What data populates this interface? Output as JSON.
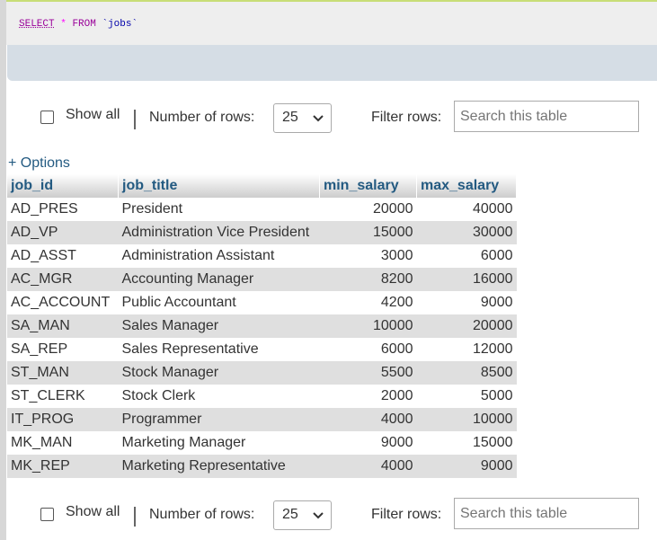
{
  "sql": {
    "keyword_select": "SELECT",
    "star": "*",
    "keyword_from": "FROM",
    "table_ident": "`jobs`"
  },
  "nav": {
    "show_all_label": "Show all",
    "rows_label": "Number of rows:",
    "rows_value": "25",
    "filter_label": "Filter rows:",
    "search_placeholder": "Search this table"
  },
  "options_label": "+ Options",
  "table": {
    "columns": [
      "job_id",
      "job_title",
      "min_salary",
      "max_salary"
    ],
    "rows": [
      [
        "AD_PRES",
        "President",
        "20000",
        "40000"
      ],
      [
        "AD_VP",
        "Administration Vice President",
        "15000",
        "30000"
      ],
      [
        "AD_ASST",
        "Administration Assistant",
        "3000",
        "6000"
      ],
      [
        "AC_MGR",
        "Accounting Manager",
        "8200",
        "16000"
      ],
      [
        "AC_ACCOUNT",
        "Public Accountant",
        "4200",
        "9000"
      ],
      [
        "SA_MAN",
        "Sales Manager",
        "10000",
        "20000"
      ],
      [
        "SA_REP",
        "Sales Representative",
        "6000",
        "12000"
      ],
      [
        "ST_MAN",
        "Stock Manager",
        "5500",
        "8500"
      ],
      [
        "ST_CLERK",
        "Stock Clerk",
        "2000",
        "5000"
      ],
      [
        "IT_PROG",
        "Programmer",
        "4000",
        "10000"
      ],
      [
        "MK_MAN",
        "Marketing Manager",
        "9000",
        "15000"
      ],
      [
        "MK_REP",
        "Marketing Representative",
        "4000",
        "9000"
      ]
    ]
  },
  "colors": {
    "header_text": "#235a81",
    "even_row": "#dfdfdf",
    "sql_background": "#eeeeee",
    "tools_background": "#d5dde5"
  },
  "icons": {
    "rows_select": "chevron-down-icon"
  }
}
